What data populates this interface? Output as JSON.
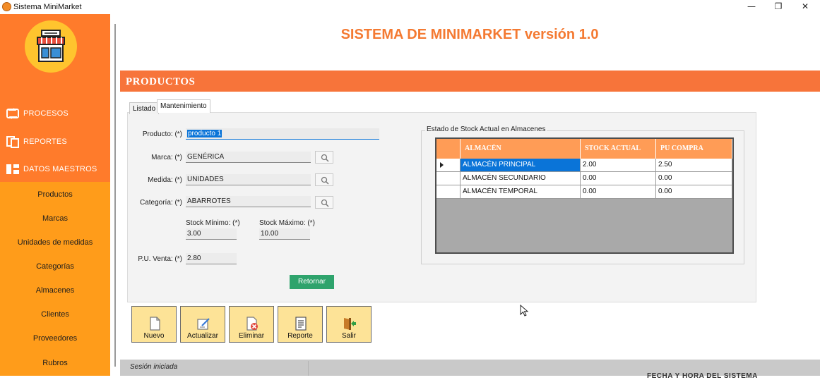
{
  "window": {
    "title": "Sistema MiniMarket",
    "controls": {
      "minimize": "—",
      "maximize": "❐",
      "close": "✕"
    }
  },
  "sidebar": {
    "main_items": [
      {
        "label": "PROCESOS",
        "icon": "cycle-icon"
      },
      {
        "label": "REPORTES",
        "icon": "documents-icon"
      },
      {
        "label": "DATOS MAESTROS",
        "icon": "hierarchy-icon"
      }
    ],
    "sub_items": [
      "Productos",
      "Marcas",
      "Unidades de medidas",
      "Categorías",
      "Almacenes",
      "Clientes",
      "Proveedores",
      "Rubros"
    ]
  },
  "header": {
    "title": "SISTEMA DE MINIMARKET versión 1.0",
    "section": "PRODUCTOS"
  },
  "tabs": {
    "listado": "Listado",
    "mantenimiento": "Mantenimiento"
  },
  "form": {
    "producto_label": "Producto: (*)",
    "producto_value": "producto 1",
    "marca_label": "Marca: (*)",
    "marca_value": "GENÉRICA",
    "medida_label": "Medida: (*)",
    "medida_value": "UNIDADES",
    "categoria_label": "Categoría: (*)",
    "categoria_value": "ABARROTES",
    "stock_min_label": "Stock Mínimo: (*)",
    "stock_min_value": "3.00",
    "stock_max_label": "Stock Máximo: (*)",
    "stock_max_value": "10.00",
    "pu_venta_label": "P.U. Venta: (*)",
    "pu_venta_value": "2.80",
    "retornar": "Retornar"
  },
  "stock": {
    "legend": "Estado de Stock Actual en Almacenes",
    "headers": [
      "ALMACÉN",
      "STOCK ACTUAL",
      "PU COMPRA"
    ],
    "rows": [
      {
        "almacen": "ALMACÉN PRINCIPAL",
        "stock": "2.00",
        "pu": "2.50"
      },
      {
        "almacen": "ALMACÉN SECUNDARIO",
        "stock": "0.00",
        "pu": "0.00"
      },
      {
        "almacen": "ALMACÉN TEMPORAL",
        "stock": "0.00",
        "pu": "0.00"
      }
    ]
  },
  "actions": {
    "nuevo": "Nuevo",
    "actualizar": "Actualizar",
    "eliminar": "Eliminar",
    "reporte": "Reporte",
    "salir": "Salir"
  },
  "status": {
    "session": "Sesión iniciada",
    "datetime": "FECHA Y HORA DEL SISTEMA"
  },
  "colors": {
    "accent": "#f7743a",
    "sidebar": "#ff9c1a",
    "grid_header": "#ff9c56",
    "button": "#fde397"
  }
}
